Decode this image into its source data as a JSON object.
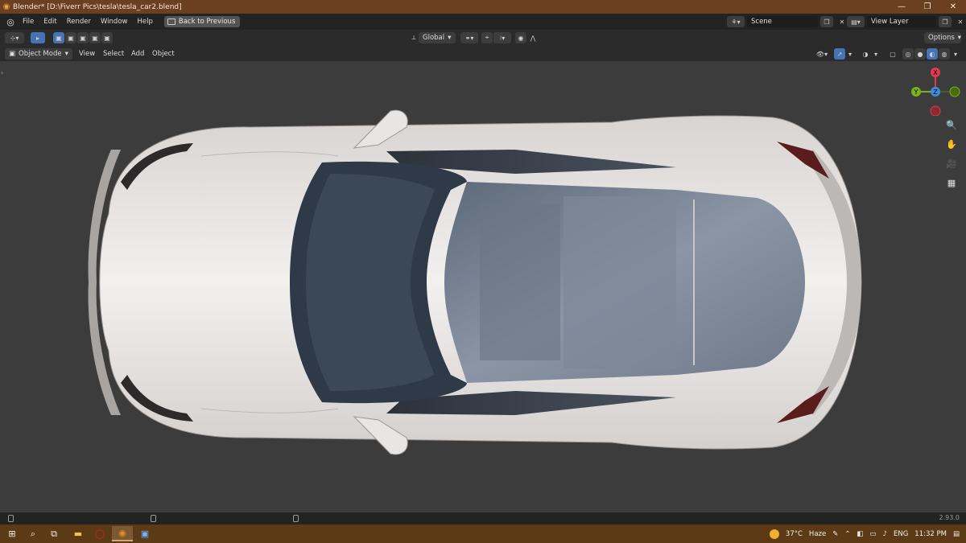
{
  "window": {
    "title": "Blender* [D:\\Fiverr Pics\\tesla\\tesla_car2.blend]",
    "min_glyph": "—",
    "max_glyph": "❐",
    "close_glyph": "✕"
  },
  "topbar": {
    "menus": [
      "File",
      "Edit",
      "Render",
      "Window",
      "Help"
    ],
    "back_label": "Back to Previous",
    "scene_label": "Scene",
    "view_layer_label": "View Layer"
  },
  "toolbar": {
    "transform_orientation": "Global",
    "options_label": "Options"
  },
  "header": {
    "mode_label": "Object Mode",
    "menus": [
      "View",
      "Select",
      "Add",
      "Object"
    ]
  },
  "gizmo": {
    "x_label": "X",
    "y_label": "Y",
    "z_label": "Z",
    "x_color": "#e23a4b",
    "y_color": "#7ab317",
    "z_color": "#3b8ddc"
  },
  "statusbar": {
    "version": "2.93.0"
  },
  "taskbar": {
    "temperature": "37°C",
    "weather": "Haze",
    "language": "ENG",
    "time": "11:32 PM"
  },
  "colors": {
    "titlebar": "#6a4020",
    "taskbar": "#5c3a16",
    "viewport": "#3c3c3c",
    "accent": "#4772b3"
  }
}
